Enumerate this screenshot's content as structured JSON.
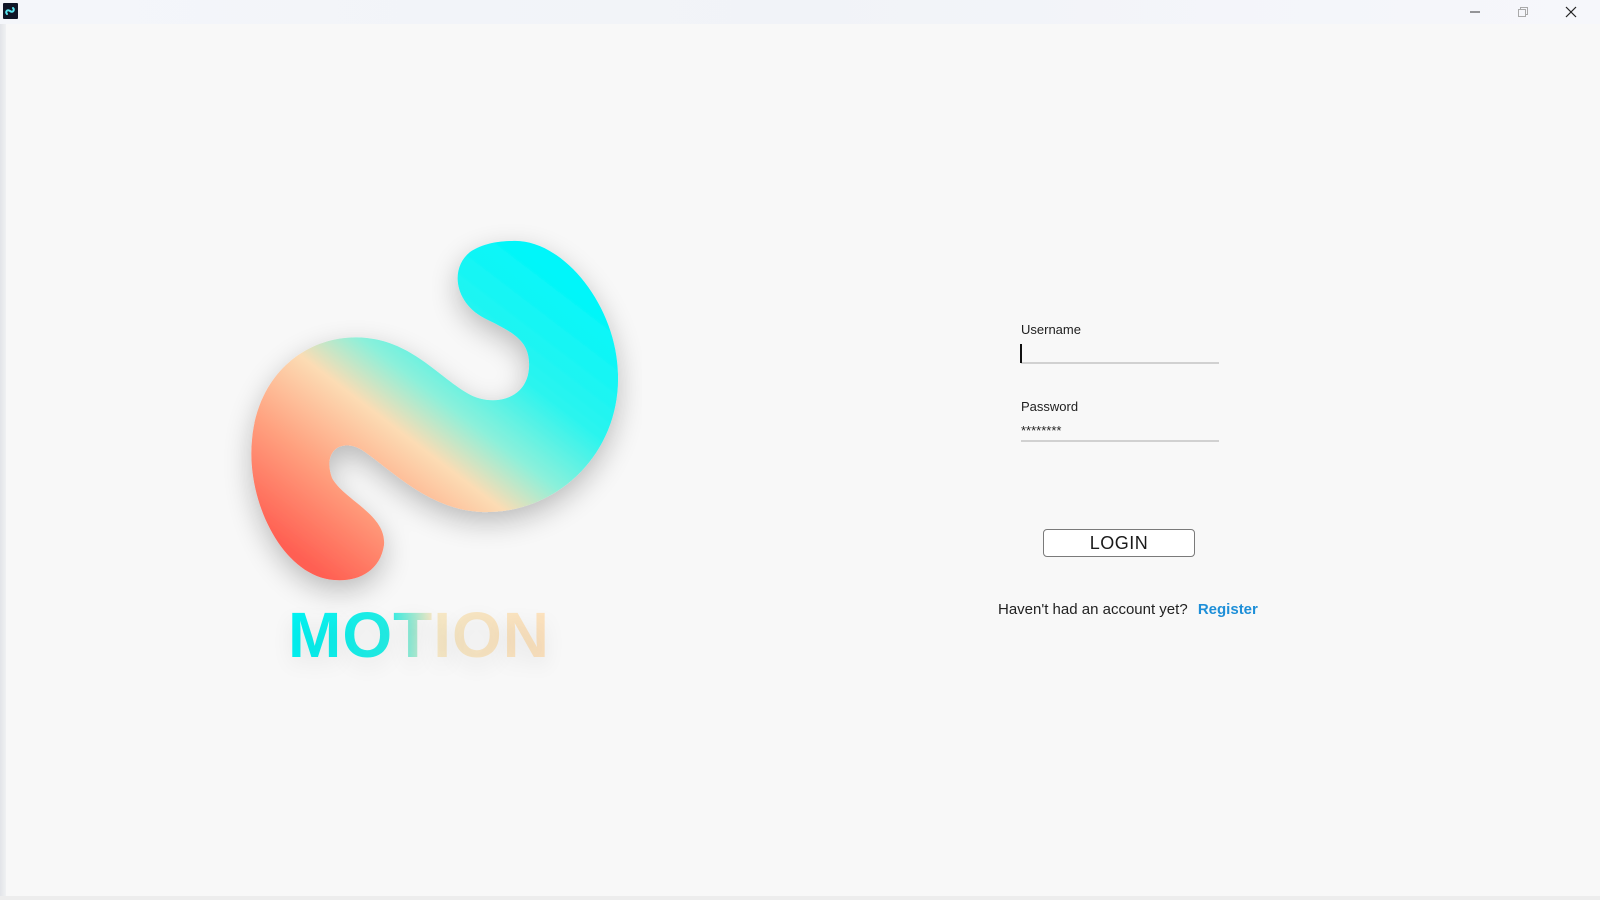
{
  "window": {
    "title": "",
    "controls": {
      "minimize_icon": "minimize-icon",
      "maximize_icon": "maximize-icon",
      "close_icon": "close-icon"
    }
  },
  "brand": {
    "name": "MOTION",
    "logo_icon": "motion-logo-icon",
    "colors": {
      "cyan": "#00f4f4",
      "peach": "#fde2be",
      "coral": "#ff6f5e"
    }
  },
  "login_form": {
    "username": {
      "label": "Username",
      "value": ""
    },
    "password": {
      "label": "Password",
      "value": "********"
    },
    "login_label": "LOGIN",
    "register_prompt": "Haven't had an account yet?",
    "register_label": "Register",
    "link_color": "#1e8fd8"
  }
}
